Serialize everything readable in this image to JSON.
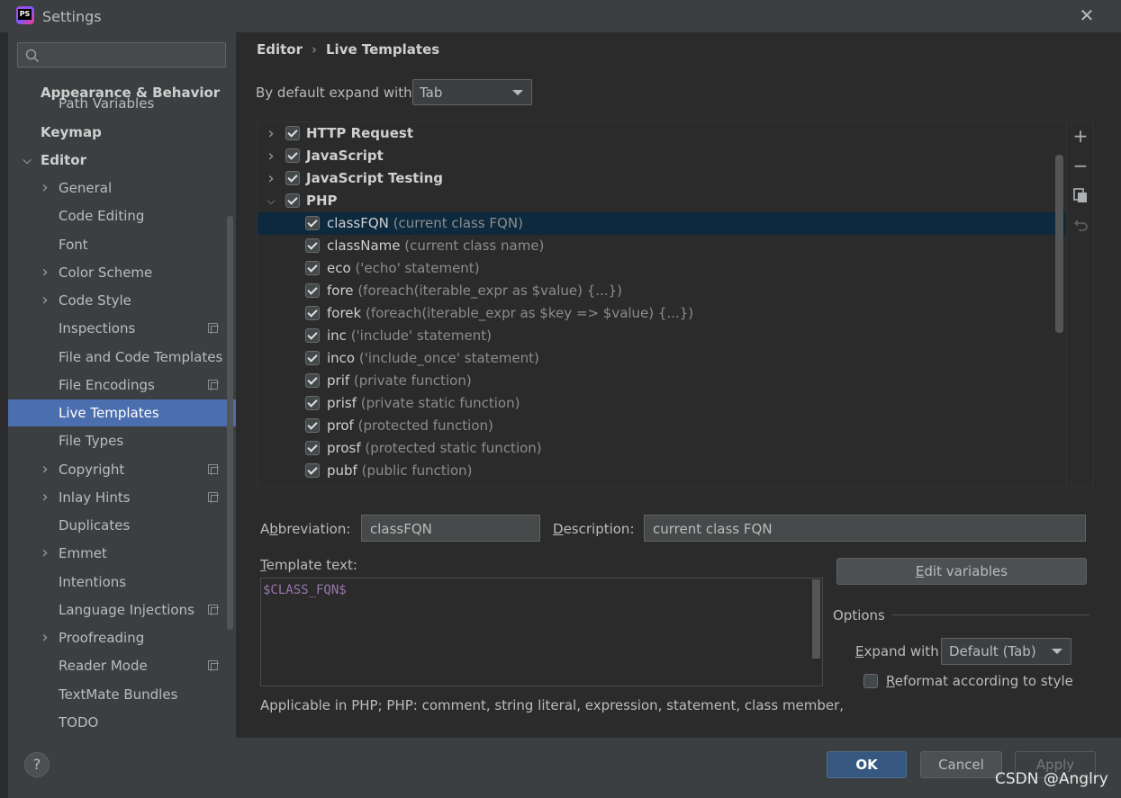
{
  "window": {
    "title": "Settings",
    "icon_text": "PS"
  },
  "sidebar": {
    "search_placeholder": "",
    "items": [
      {
        "label": "Appearance & Behavior",
        "level": 0,
        "bold": true
      },
      {
        "label": "Path Variables",
        "level": 1
      },
      {
        "label": "Keymap",
        "level": 0,
        "bold": true
      },
      {
        "label": "Editor",
        "level": 0,
        "bold": true,
        "expanded": true
      },
      {
        "label": "General",
        "level": 1,
        "collapsed": true
      },
      {
        "label": "Code Editing",
        "level": 1
      },
      {
        "label": "Font",
        "level": 1
      },
      {
        "label": "Color Scheme",
        "level": 1,
        "collapsed": true
      },
      {
        "label": "Code Style",
        "level": 1,
        "collapsed": true
      },
      {
        "label": "Inspections",
        "level": 1,
        "project": true
      },
      {
        "label": "File and Code Templates",
        "level": 1
      },
      {
        "label": "File Encodings",
        "level": 1,
        "project": true
      },
      {
        "label": "Live Templates",
        "level": 1,
        "selected": true
      },
      {
        "label": "File Types",
        "level": 1
      },
      {
        "label": "Copyright",
        "level": 1,
        "collapsed": true,
        "project": true
      },
      {
        "label": "Inlay Hints",
        "level": 1,
        "collapsed": true,
        "project": true
      },
      {
        "label": "Duplicates",
        "level": 1
      },
      {
        "label": "Emmet",
        "level": 1,
        "collapsed": true
      },
      {
        "label": "Intentions",
        "level": 1
      },
      {
        "label": "Language Injections",
        "level": 1,
        "project": true
      },
      {
        "label": "Proofreading",
        "level": 1,
        "collapsed": true
      },
      {
        "label": "Reader Mode",
        "level": 1,
        "project": true
      },
      {
        "label": "TextMate Bundles",
        "level": 1
      },
      {
        "label": "TODO",
        "level": 1
      }
    ]
  },
  "breadcrumb": {
    "parent": "Editor",
    "separator": "›",
    "current": "Live Templates"
  },
  "expand": {
    "label": "By default expand with",
    "value": "Tab"
  },
  "tree": {
    "groups": [
      {
        "name": "HTTP Request",
        "checked": true,
        "expanded": false
      },
      {
        "name": "JavaScript",
        "checked": true,
        "expanded": false
      },
      {
        "name": "JavaScript Testing",
        "checked": true,
        "expanded": false
      },
      {
        "name": "PHP",
        "checked": true,
        "expanded": true
      }
    ],
    "templates": [
      {
        "abbr": "classFQN",
        "desc": "(current class FQN)",
        "checked": true,
        "selected": true
      },
      {
        "abbr": "className",
        "desc": "(current class name)",
        "checked": true
      },
      {
        "abbr": "eco",
        "desc": "('echo' statement)",
        "checked": true
      },
      {
        "abbr": "fore",
        "desc": "(foreach(iterable_expr as $value) {...})",
        "checked": true
      },
      {
        "abbr": "forek",
        "desc": "(foreach(iterable_expr as $key => $value) {...})",
        "checked": true
      },
      {
        "abbr": "inc",
        "desc": "('include' statement)",
        "checked": true
      },
      {
        "abbr": "inco",
        "desc": "('include_once' statement)",
        "checked": true
      },
      {
        "abbr": "prif",
        "desc": "(private function)",
        "checked": true
      },
      {
        "abbr": "prisf",
        "desc": "(private static function)",
        "checked": true
      },
      {
        "abbr": "prof",
        "desc": "(protected function)",
        "checked": true
      },
      {
        "abbr": "prosf",
        "desc": "(protected static function)",
        "checked": true
      },
      {
        "abbr": "pubf",
        "desc": "(public function)",
        "checked": true
      }
    ]
  },
  "editor": {
    "abbreviation_label_pre": "A",
    "abbreviation_label_u": "b",
    "abbreviation_label_post": "breviation:",
    "abbreviation_value": "classFQN",
    "description_label_u": "D",
    "description_label_post": "escription:",
    "description_value": "current class FQN",
    "template_text_label_u": "T",
    "template_text_label_post": "emplate text:",
    "template_text": "$CLASS_FQN$",
    "applicable": "Applicable in PHP; PHP: comment, string literal, expression, statement, class member,",
    "edit_variables_u": "E",
    "edit_variables_post": "dit variables",
    "options_label": "Options",
    "expand_with_u": "E",
    "expand_with_post": "xpand with",
    "expand_with_value": "Default (Tab)",
    "reformat_u": "R",
    "reformat_post": "eformat according to style",
    "reformat_checked": false
  },
  "buttons": {
    "help": "?",
    "ok": "OK",
    "cancel": "Cancel",
    "apply": "Apply"
  },
  "watermark": "CSDN @Anglry"
}
